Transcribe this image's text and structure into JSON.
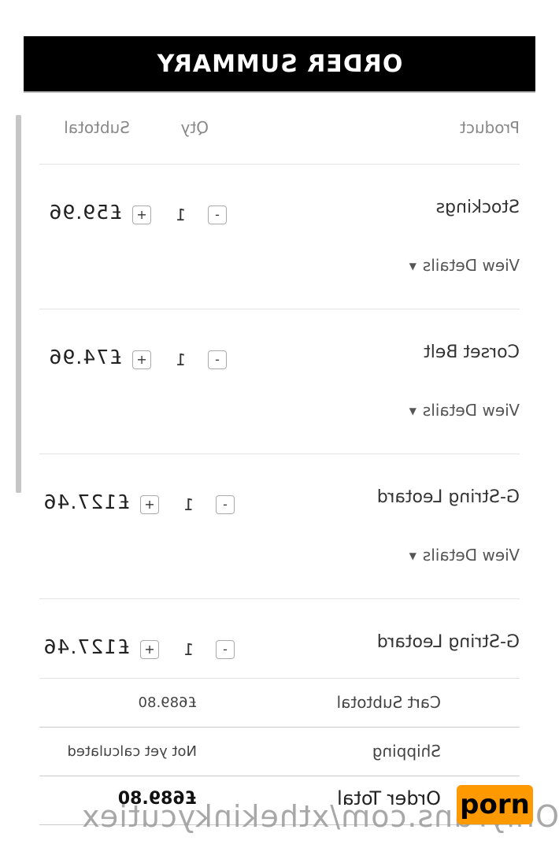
{
  "header": {
    "title": "ORDER SUMMARY"
  },
  "columns": {
    "product": "Product",
    "qty": "Qty",
    "subtotal": "Subtotal"
  },
  "items": [
    {
      "name": "Stockings",
      "details_label": "View Details",
      "qty": "1",
      "minus": "-",
      "plus": "+",
      "subtotal": "£59.96"
    },
    {
      "name": "Corset Belt",
      "details_label": "View Details",
      "qty": "1",
      "minus": "-",
      "plus": "+",
      "subtotal": "£74.96"
    },
    {
      "name": "G-String Leotard",
      "details_label": "View Details",
      "qty": "1",
      "minus": "-",
      "plus": "+",
      "subtotal": "£127.46"
    },
    {
      "name": "G-String Leotard",
      "qty": "1",
      "minus": "-",
      "plus": "+",
      "subtotal": "£127.46"
    }
  ],
  "summary": {
    "cart_subtotal_label": "Cart Subtotal",
    "cart_subtotal_value": "£689.80",
    "shipping_label": "Shipping",
    "shipping_value": "Not yet calculated",
    "order_total_label": "Order Total",
    "order_total_value": "£689.80"
  },
  "watermark": {
    "text": "OnlyFans.com/xthekinkycutiex",
    "logo_text": "porn"
  }
}
